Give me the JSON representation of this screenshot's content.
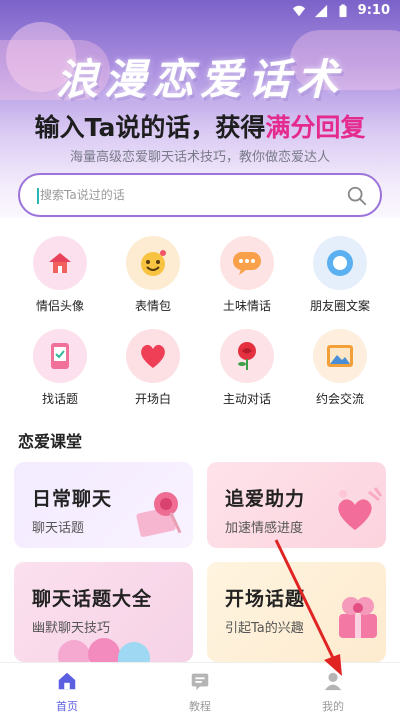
{
  "status_bar": {
    "time": "9:10"
  },
  "hero": {
    "banner_title": "浪漫恋爱话术",
    "headline_prefix": "输入Ta说的话，获得",
    "headline_highlight": "满分回复",
    "subline": "海量高级恋爱聊天话术技巧，教你做恋爱达人"
  },
  "search": {
    "placeholder": "搜索Ta说过的话"
  },
  "categories": [
    {
      "label": "情侣头像",
      "icon": "house-icon"
    },
    {
      "label": "表情包",
      "icon": "emoji-icon"
    },
    {
      "label": "土味情话",
      "icon": "chat-bubble-icon"
    },
    {
      "label": "朋友圈文案",
      "icon": "ring-icon"
    },
    {
      "label": "找话题",
      "icon": "phone-icon"
    },
    {
      "label": "开场白",
      "icon": "heart-icon"
    },
    {
      "label": "主动对话",
      "icon": "rose-icon"
    },
    {
      "label": "约会交流",
      "icon": "picture-icon"
    }
  ],
  "section": {
    "title": "恋爱课堂"
  },
  "cards": [
    {
      "title": "日常聊天",
      "subtitle": "聊天话题"
    },
    {
      "title": "追爱助力",
      "subtitle": "加速情感进度"
    },
    {
      "title": "聊天话题大全",
      "subtitle": "幽默聊天技巧"
    },
    {
      "title": "开场话题",
      "subtitle": "引起Ta的兴趣"
    }
  ],
  "tabs": [
    {
      "label": "首页",
      "icon": "home-icon",
      "active": true
    },
    {
      "label": "教程",
      "icon": "tutorial-icon",
      "active": false
    },
    {
      "label": "我的",
      "icon": "profile-icon",
      "active": false
    }
  ],
  "colors": {
    "accent": "#5b5fe0",
    "highlight": "#e52a8e",
    "search_border": "#9b73d9"
  }
}
